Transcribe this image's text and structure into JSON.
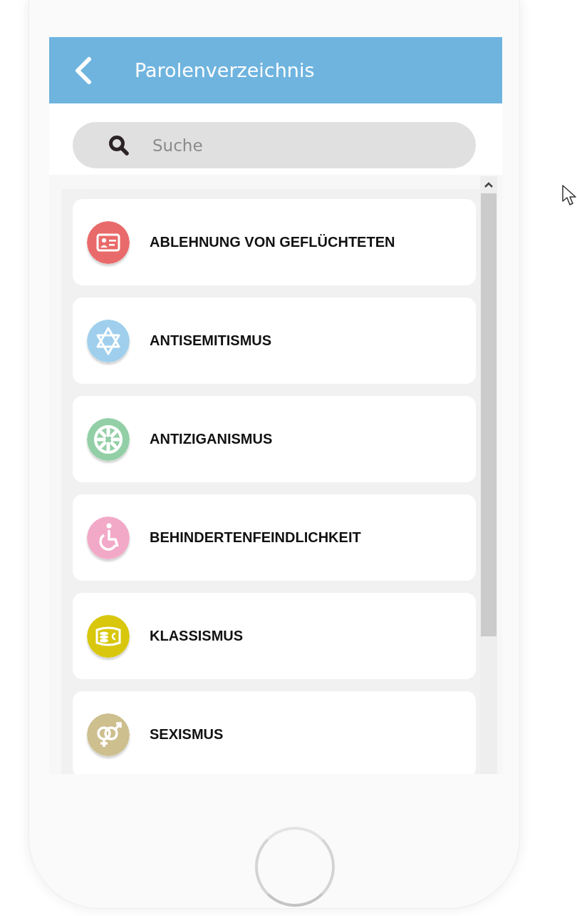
{
  "header": {
    "title": "Parolenverzeichnis"
  },
  "search": {
    "placeholder": "Suche"
  },
  "categories": [
    {
      "label": "ABLEHNUNG VON GEFLÜCHTETEN",
      "color": "#e96a6a"
    },
    {
      "label": "ANTISEMITISMUS",
      "color": "#9fcfec"
    },
    {
      "label": "ANTIZIGANISMUS",
      "color": "#93cfa6"
    },
    {
      "label": "BEHINDERTENFEINDLICHKEIT",
      "color": "#f2a9c8"
    },
    {
      "label": "KLASSISMUS",
      "color": "#d8c70c"
    },
    {
      "label": "SEXISMUS",
      "color": "#cdbf8e"
    }
  ]
}
